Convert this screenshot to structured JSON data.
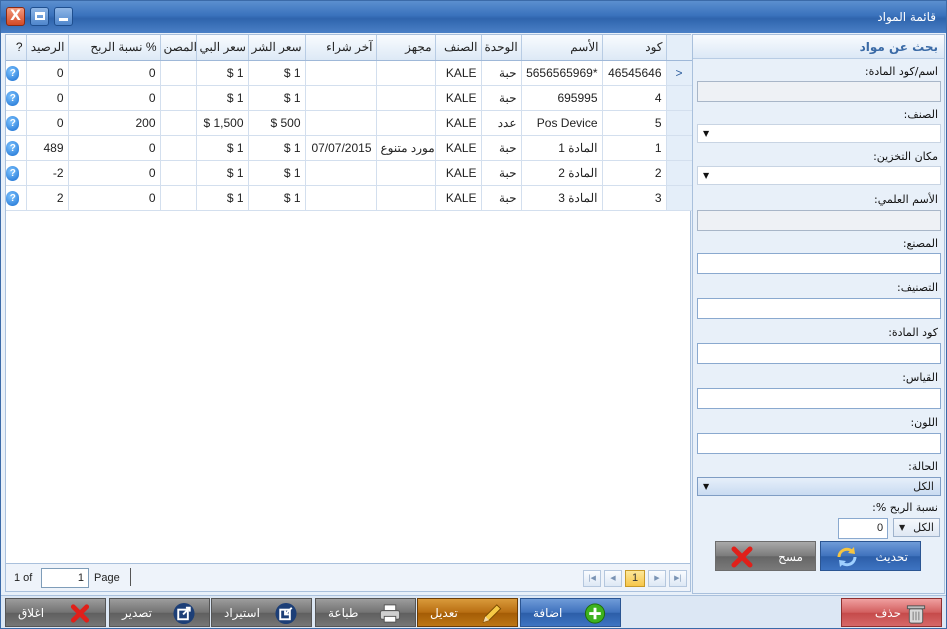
{
  "window": {
    "title": "قائمة المواد",
    "close_label": "X"
  },
  "grid": {
    "columns": [
      "?",
      "الرصيد",
      "نسبة الربح %",
      "المصن",
      "سعر البي",
      "سعر الشر",
      "آخر شراء",
      "مجهز",
      "الصنف",
      "الوحدة",
      "الأسم",
      "كود"
    ],
    "row_indicator": ">",
    "help_glyph": "?",
    "rows": [
      {
        "stock": "0",
        "profit": "0",
        "mfr": "",
        "sell": "$ 1",
        "buy": "$ 1",
        "last": "",
        "supplier": "",
        "category": "KALE",
        "unit": "حبة",
        "name": "5656565969*",
        "code": "46545646"
      },
      {
        "stock": "0",
        "profit": "0",
        "mfr": "",
        "sell": "$ 1",
        "buy": "$ 1",
        "last": "",
        "supplier": "",
        "category": "KALE",
        "unit": "حبة",
        "name": "695995",
        "code": "4"
      },
      {
        "stock": "0",
        "profit": "200",
        "mfr": "",
        "sell": "$ 1,500",
        "buy": "$ 500",
        "last": "",
        "supplier": "",
        "category": "KALE",
        "unit": "عدد",
        "name": "Pos Device",
        "code": "5"
      },
      {
        "stock": "489",
        "profit": "0",
        "mfr": "",
        "sell": "$ 1",
        "buy": "$ 1",
        "last": "07/07/2015",
        "supplier": "مورد متنوع",
        "category": "KALE",
        "unit": "حبة",
        "name": "المادة 1",
        "code": "1"
      },
      {
        "stock": "-2",
        "profit": "0",
        "mfr": "",
        "sell": "$ 1",
        "buy": "$ 1",
        "last": "",
        "supplier": "",
        "category": "KALE",
        "unit": "حبة",
        "name": "المادة 2",
        "code": "2"
      },
      {
        "stock": "2",
        "profit": "0",
        "mfr": "",
        "sell": "$ 1",
        "buy": "$ 1",
        "last": "",
        "supplier": "",
        "category": "KALE",
        "unit": "حبة",
        "name": "المادة 3",
        "code": "3"
      }
    ]
  },
  "pager": {
    "of_label": "1 of",
    "page_value": "1",
    "page_label": "Page",
    "current_page": "1"
  },
  "search": {
    "header": "بحث عن مواد",
    "name_code_label": "اسم/كود المادة:",
    "category_label": "الصنف:",
    "storage_label": "مكان التخزين:",
    "scientific_label": "الأسم العلمي:",
    "manufacturer_label": "المصنع:",
    "classification_label": "التصنيف:",
    "item_code_label": "كود المادة:",
    "size_label": "القياس:",
    "color_label": "اللون:",
    "status_label": "الحالة:",
    "status_value": "الكل",
    "profit_label": "نسبة الربح %:",
    "profit_op_value": "الكل",
    "profit_value": "0",
    "refresh_label": "تحديث",
    "clear_label": "مسح"
  },
  "toolbar": {
    "close_label": "اغلاق",
    "export_label": "تصدير",
    "import_label": "استيراد",
    "print_label": "طباعة",
    "edit_label": "تعديل",
    "add_label": "اضافة",
    "delete_label": "حذف"
  },
  "colors": {
    "titlebar": "#3a72bd",
    "accent_blue": "#3f72bd",
    "edit_orange": "#b86e12",
    "delete_red": "#d25f5f"
  }
}
